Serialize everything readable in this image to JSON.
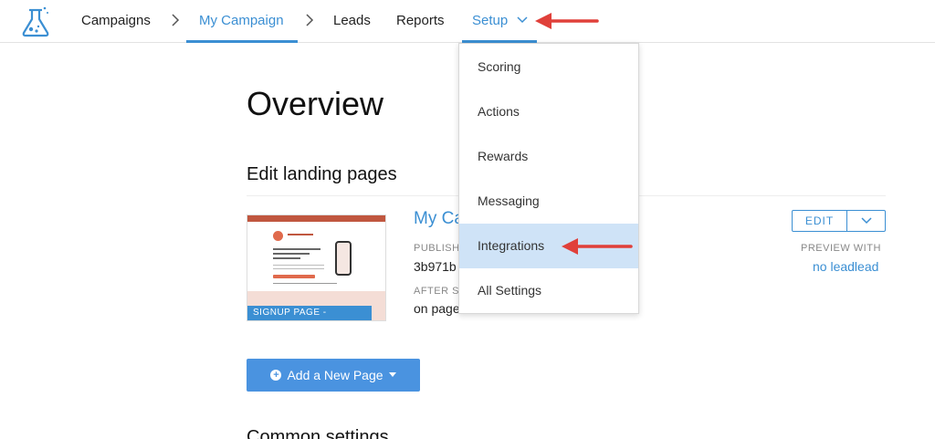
{
  "nav": {
    "logo": "flask-logo-icon",
    "items": [
      {
        "label": "Campaigns"
      },
      {
        "label": "My Campaign"
      },
      {
        "label": "Leads"
      },
      {
        "label": "Reports"
      },
      {
        "label": "Setup"
      }
    ],
    "active_item": "My Campaign",
    "accent_color": "#3b8fd3"
  },
  "main": {
    "title": "Overview",
    "section_title": "Edit landing pages",
    "landing_page": {
      "title": "My Ca",
      "thumbnail_badge": "SIGNUP PAGE - DEFAULT",
      "publish_label": "PUBLISH",
      "publish_value": "3b971b",
      "after_label": "AFTER S",
      "after_value": "on page",
      "edit_label": "EDIT",
      "preview_label": "PREVIEW WITH",
      "preview_link": "no leadlead"
    },
    "add_page_label": "Add a New Page",
    "common_settings_title": "Common settings"
  },
  "setup_menu": {
    "items": [
      {
        "label": "Scoring"
      },
      {
        "label": "Actions"
      },
      {
        "label": "Rewards"
      },
      {
        "label": "Messaging"
      },
      {
        "label": "Integrations",
        "highlighted": true
      },
      {
        "label": "All Settings"
      }
    ],
    "highlight_color": "#cfe3f7"
  },
  "annotations": {
    "arrow_color": "#e0403a"
  }
}
